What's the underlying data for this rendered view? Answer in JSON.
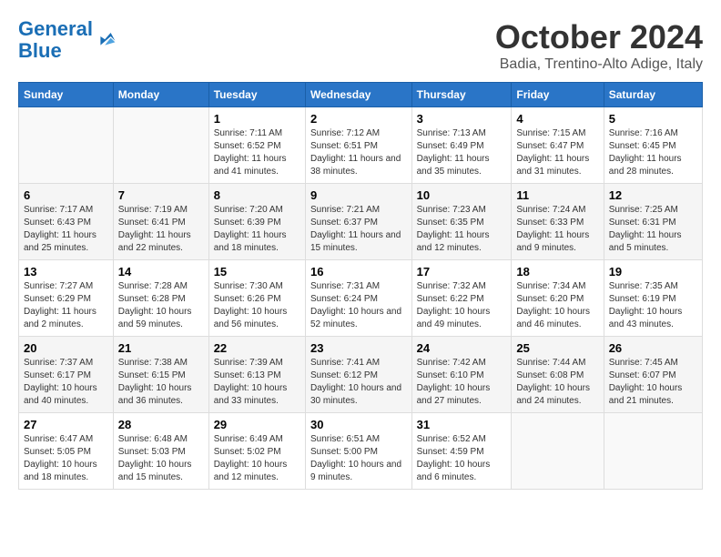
{
  "header": {
    "logo_line1": "General",
    "logo_line2": "Blue",
    "month": "October 2024",
    "location": "Badia, Trentino-Alto Adige, Italy"
  },
  "weekdays": [
    "Sunday",
    "Monday",
    "Tuesday",
    "Wednesday",
    "Thursday",
    "Friday",
    "Saturday"
  ],
  "weeks": [
    [
      {
        "day": "",
        "detail": ""
      },
      {
        "day": "",
        "detail": ""
      },
      {
        "day": "1",
        "detail": "Sunrise: 7:11 AM\nSunset: 6:52 PM\nDaylight: 11 hours and 41 minutes."
      },
      {
        "day": "2",
        "detail": "Sunrise: 7:12 AM\nSunset: 6:51 PM\nDaylight: 11 hours and 38 minutes."
      },
      {
        "day": "3",
        "detail": "Sunrise: 7:13 AM\nSunset: 6:49 PM\nDaylight: 11 hours and 35 minutes."
      },
      {
        "day": "4",
        "detail": "Sunrise: 7:15 AM\nSunset: 6:47 PM\nDaylight: 11 hours and 31 minutes."
      },
      {
        "day": "5",
        "detail": "Sunrise: 7:16 AM\nSunset: 6:45 PM\nDaylight: 11 hours and 28 minutes."
      }
    ],
    [
      {
        "day": "6",
        "detail": "Sunrise: 7:17 AM\nSunset: 6:43 PM\nDaylight: 11 hours and 25 minutes."
      },
      {
        "day": "7",
        "detail": "Sunrise: 7:19 AM\nSunset: 6:41 PM\nDaylight: 11 hours and 22 minutes."
      },
      {
        "day": "8",
        "detail": "Sunrise: 7:20 AM\nSunset: 6:39 PM\nDaylight: 11 hours and 18 minutes."
      },
      {
        "day": "9",
        "detail": "Sunrise: 7:21 AM\nSunset: 6:37 PM\nDaylight: 11 hours and 15 minutes."
      },
      {
        "day": "10",
        "detail": "Sunrise: 7:23 AM\nSunset: 6:35 PM\nDaylight: 11 hours and 12 minutes."
      },
      {
        "day": "11",
        "detail": "Sunrise: 7:24 AM\nSunset: 6:33 PM\nDaylight: 11 hours and 9 minutes."
      },
      {
        "day": "12",
        "detail": "Sunrise: 7:25 AM\nSunset: 6:31 PM\nDaylight: 11 hours and 5 minutes."
      }
    ],
    [
      {
        "day": "13",
        "detail": "Sunrise: 7:27 AM\nSunset: 6:29 PM\nDaylight: 11 hours and 2 minutes."
      },
      {
        "day": "14",
        "detail": "Sunrise: 7:28 AM\nSunset: 6:28 PM\nDaylight: 10 hours and 59 minutes."
      },
      {
        "day": "15",
        "detail": "Sunrise: 7:30 AM\nSunset: 6:26 PM\nDaylight: 10 hours and 56 minutes."
      },
      {
        "day": "16",
        "detail": "Sunrise: 7:31 AM\nSunset: 6:24 PM\nDaylight: 10 hours and 52 minutes."
      },
      {
        "day": "17",
        "detail": "Sunrise: 7:32 AM\nSunset: 6:22 PM\nDaylight: 10 hours and 49 minutes."
      },
      {
        "day": "18",
        "detail": "Sunrise: 7:34 AM\nSunset: 6:20 PM\nDaylight: 10 hours and 46 minutes."
      },
      {
        "day": "19",
        "detail": "Sunrise: 7:35 AM\nSunset: 6:19 PM\nDaylight: 10 hours and 43 minutes."
      }
    ],
    [
      {
        "day": "20",
        "detail": "Sunrise: 7:37 AM\nSunset: 6:17 PM\nDaylight: 10 hours and 40 minutes."
      },
      {
        "day": "21",
        "detail": "Sunrise: 7:38 AM\nSunset: 6:15 PM\nDaylight: 10 hours and 36 minutes."
      },
      {
        "day": "22",
        "detail": "Sunrise: 7:39 AM\nSunset: 6:13 PM\nDaylight: 10 hours and 33 minutes."
      },
      {
        "day": "23",
        "detail": "Sunrise: 7:41 AM\nSunset: 6:12 PM\nDaylight: 10 hours and 30 minutes."
      },
      {
        "day": "24",
        "detail": "Sunrise: 7:42 AM\nSunset: 6:10 PM\nDaylight: 10 hours and 27 minutes."
      },
      {
        "day": "25",
        "detail": "Sunrise: 7:44 AM\nSunset: 6:08 PM\nDaylight: 10 hours and 24 minutes."
      },
      {
        "day": "26",
        "detail": "Sunrise: 7:45 AM\nSunset: 6:07 PM\nDaylight: 10 hours and 21 minutes."
      }
    ],
    [
      {
        "day": "27",
        "detail": "Sunrise: 6:47 AM\nSunset: 5:05 PM\nDaylight: 10 hours and 18 minutes."
      },
      {
        "day": "28",
        "detail": "Sunrise: 6:48 AM\nSunset: 5:03 PM\nDaylight: 10 hours and 15 minutes."
      },
      {
        "day": "29",
        "detail": "Sunrise: 6:49 AM\nSunset: 5:02 PM\nDaylight: 10 hours and 12 minutes."
      },
      {
        "day": "30",
        "detail": "Sunrise: 6:51 AM\nSunset: 5:00 PM\nDaylight: 10 hours and 9 minutes."
      },
      {
        "day": "31",
        "detail": "Sunrise: 6:52 AM\nSunset: 4:59 PM\nDaylight: 10 hours and 6 minutes."
      },
      {
        "day": "",
        "detail": ""
      },
      {
        "day": "",
        "detail": ""
      }
    ]
  ]
}
